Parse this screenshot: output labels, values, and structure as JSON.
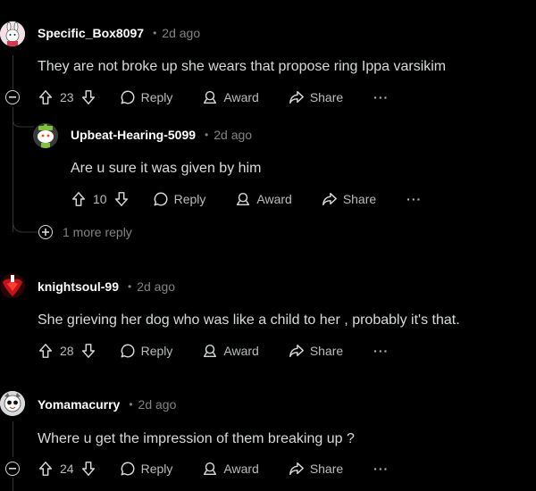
{
  "comments": [
    {
      "author": "Specific_Box8097",
      "time": "2d ago",
      "text": "They are not broke up she wears that propose ring Ippa varsikim",
      "votes": "23",
      "reply_label": "Reply",
      "award_label": "Award",
      "share_label": "Share",
      "more_label": "···"
    },
    {
      "author": "Upbeat-Hearing-5099",
      "time": "2d ago",
      "text": "Are u sure it was given by him",
      "votes": "10",
      "reply_label": "Reply",
      "award_label": "Award",
      "share_label": "Share",
      "more_label": "···"
    },
    {
      "author": "knightsoul-99",
      "time": "2d ago",
      "text": "She grieving her dog who was like a child to her , probably it's that.",
      "votes": "28",
      "reply_label": "Reply",
      "award_label": "Award",
      "share_label": "Share",
      "more_label": "···"
    },
    {
      "author": "Yomamacurry",
      "time": "2d ago",
      "text": "Where u get the impression of them breaking up ?",
      "votes": "24",
      "reply_label": "Reply",
      "award_label": "Award",
      "share_label": "Share",
      "more_label": "···"
    }
  ],
  "more_replies": "1 more reply",
  "separator": "•",
  "colors": {
    "background": "#000000",
    "text": "#d7dadc",
    "meta": "#818384",
    "thread_line": "#343536"
  }
}
